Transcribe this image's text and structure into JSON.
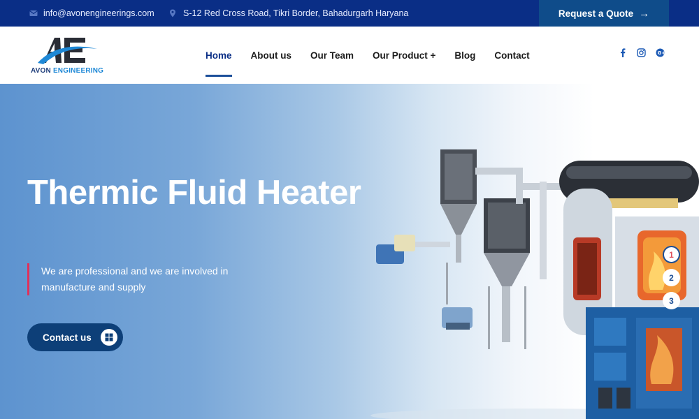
{
  "topbar": {
    "email": "info@avonengineerings.com",
    "address": "S-12 Red Cross Road, Tikri Border, Bahadurgarh Haryana",
    "quote_label": "Request a Quote",
    "quote_icon": "arrow-right-icon",
    "email_icon": "envelope-icon",
    "address_icon": "map-pin-icon",
    "background_color": "#0a2e86",
    "quote_bg": "#0f4c8a"
  },
  "brand": {
    "logo_mark": "AE",
    "name_part1": "AVON ",
    "name_part2": "ENGINEERING"
  },
  "nav": {
    "items": [
      {
        "label": "Home",
        "active": true
      },
      {
        "label": "About us"
      },
      {
        "label": "Our Team"
      },
      {
        "label": "Our Product +"
      },
      {
        "label": "Blog"
      },
      {
        "label": "Contact"
      }
    ],
    "active_color": "#1c4f9a"
  },
  "social": {
    "icons": [
      "facebook-icon",
      "instagram-icon",
      "google-plus-icon"
    ]
  },
  "hero": {
    "title": "Thermic Fluid Heater",
    "subtitle_line1": "We are professional and we are involved in",
    "subtitle_line2": "manufacture and supply",
    "cta_label": "Contact us",
    "cta_icon": "grid-icon",
    "accent_color": "#e0315b",
    "image_icon": "thermic-fluid-heater-illustration",
    "slides": [
      "1",
      "2",
      "3"
    ],
    "active_slide": "1"
  }
}
